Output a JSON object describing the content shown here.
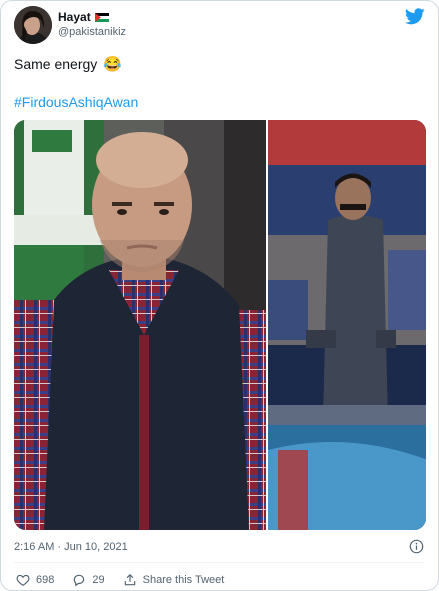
{
  "author": {
    "name": "Hayat",
    "flag_icon": "palestine-flag-icon",
    "handle": "@pakistanikiz"
  },
  "tweet": {
    "text": "Same energy",
    "emoji": "😂",
    "hashtag": "#FirdousAshiqAwan"
  },
  "meta": {
    "timestamp": "2:16 AM · Jun 10, 2021"
  },
  "actions": {
    "likes": "698",
    "replies": "29",
    "share_label": "Share this Tweet"
  },
  "colors": {
    "accent": "#1d9bf0",
    "text": "#0f1419",
    "secondary": "#536471",
    "border": "#cfd9de"
  }
}
